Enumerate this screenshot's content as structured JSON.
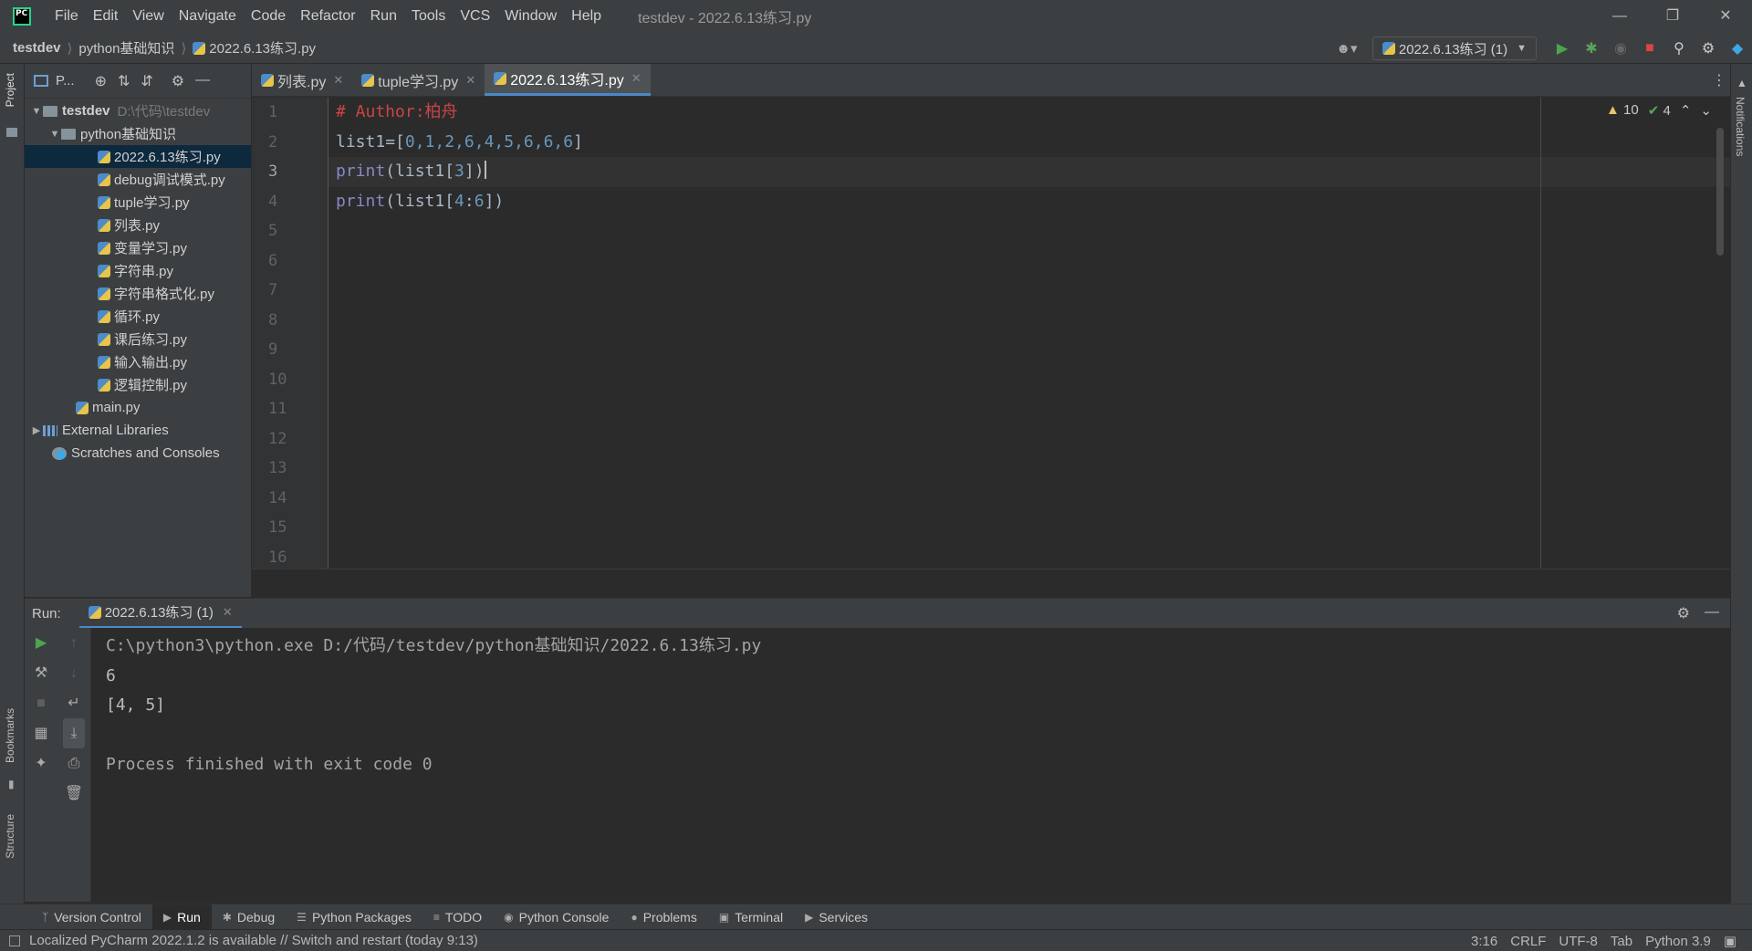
{
  "titlebar": {
    "menu": [
      "File",
      "Edit",
      "View",
      "Navigate",
      "Code",
      "Refactor",
      "Run",
      "Tools",
      "VCS",
      "Window",
      "Help"
    ],
    "title": "testdev - 2022.6.13练习.py"
  },
  "navbar": {
    "breadcrumb": [
      "testdev",
      "python基础知识",
      "2022.6.13练习.py"
    ],
    "run_config": "2022.6.13练习 (1)"
  },
  "sidebar_stripe": {
    "project": "Project",
    "bookmarks": "Bookmarks",
    "structure": "Structure"
  },
  "right_stripe": {
    "notifications": "Notifications"
  },
  "project": {
    "toolbar_label": "P...",
    "tree": {
      "root": {
        "label": "testdev",
        "path": "D:\\代码\\testdev"
      },
      "folder": "python基础知识",
      "files": [
        "2022.6.13练习.py",
        "debug调试模式.py",
        "tuple学习.py",
        "列表.py",
        "变量学习.py",
        "字符串.py",
        "字符串格式化.py",
        "循环.py",
        "课后练习.py",
        "输入输出.py",
        "逻辑控制.py"
      ],
      "selected_file": "2022.6.13练习.py",
      "main": "main.py",
      "external_libraries": "External Libraries",
      "scratches": "Scratches and Consoles"
    }
  },
  "editor": {
    "tabs": [
      {
        "label": "列表.py",
        "active": false
      },
      {
        "label": "tuple学习.py",
        "active": false
      },
      {
        "label": "2022.6.13练习.py",
        "active": true
      }
    ],
    "line_numbers": [
      "1",
      "2",
      "3",
      "4",
      "5",
      "6",
      "7",
      "8",
      "9",
      "10",
      "11",
      "12",
      "13",
      "14",
      "15",
      "16"
    ],
    "current_line": 3,
    "code": {
      "line1": "# Author:柏舟",
      "line2_name": "list1",
      "line2_rest": "=[",
      "line2_values": "0,1,2,6,4,5,6,6,6",
      "line2_end": "]",
      "line3_fn": "print",
      "line3_a": "(list1[",
      "line3_num": "3",
      "line3_b": "])",
      "line4_fn": "print",
      "line4_a": "(list1[",
      "line4_num1": "4",
      "line4_colon": ":",
      "line4_num2": "6",
      "line4_b": "])"
    },
    "inspection": {
      "warnings": "10",
      "weak": "4"
    }
  },
  "run": {
    "label": "Run:",
    "tab": "2022.6.13练习 (1)",
    "console": [
      "C:\\python3\\python.exe D:/代码/testdev/python基础知识/2022.6.13练习.py",
      "6",
      "[4, 5]",
      "",
      "Process finished with exit code 0"
    ]
  },
  "bottom_tools": [
    "Version Control",
    "Run",
    "Debug",
    "Python Packages",
    "TODO",
    "Python Console",
    "Problems",
    "Terminal",
    "Services"
  ],
  "status": {
    "message": "Localized PyCharm 2022.1.2 is available // Switch and restart (today 9:13)",
    "position": "3:16",
    "line_sep": "CRLF",
    "encoding": "UTF-8",
    "indent": "Tab",
    "interpreter": "Python 3.9"
  }
}
